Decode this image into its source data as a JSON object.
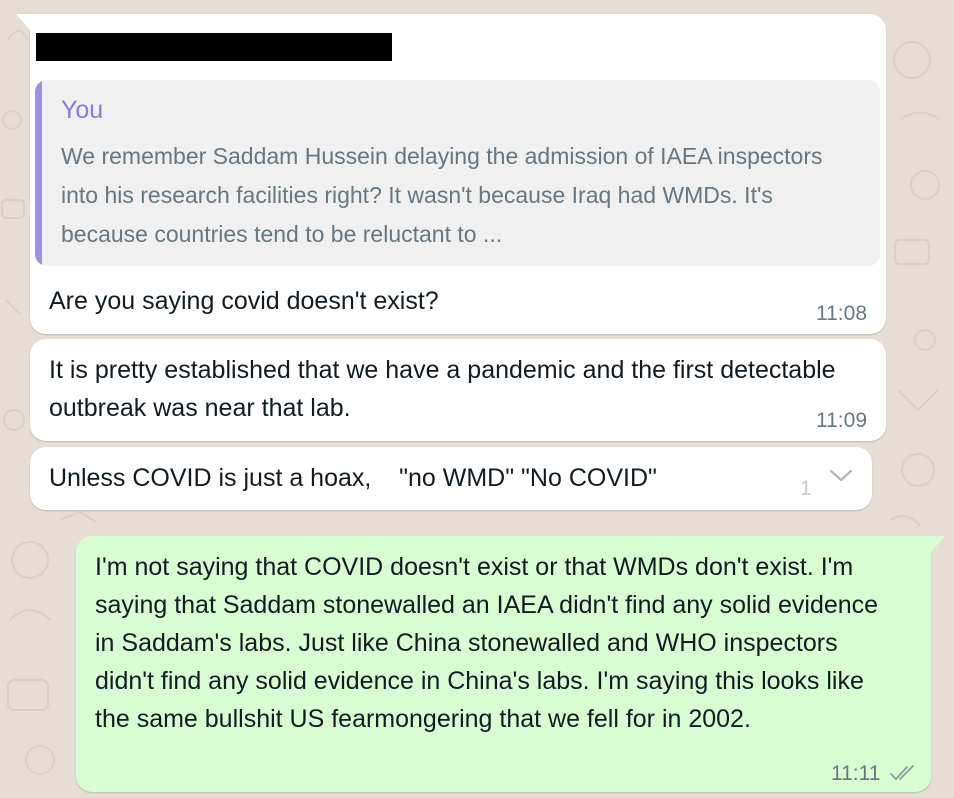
{
  "chat": {
    "messages": [
      {
        "direction": "incoming",
        "reply_quote": {
          "author": "You",
          "text": "We remember Saddam Hussein delaying the admission of IAEA inspectors into his research facilities right? It wasn't because Iraq had WMDs. It's because countries tend to be reluctant to ..."
        },
        "text": "Are you saying covid doesn't exist?",
        "time": "11:08"
      },
      {
        "direction": "incoming",
        "text": "It is pretty established that we have a pandemic and the first detectable outbreak was near that lab.",
        "time": "11:09"
      },
      {
        "direction": "incoming",
        "text": "Unless COVID is just a hoax,    \"no WMD\" \"No COVID\"",
        "faint_count": "1",
        "menu_icon": "chevron-down-icon"
      },
      {
        "direction": "outgoing",
        "text": "I'm not saying that COVID doesn't exist or that WMDs don't exist. I'm saying that Saddam stonewalled an IAEA didn't find any solid evidence in Saddam's labs. Just like China stonewalled and WHO inspectors didn't find any solid evidence in China's labs. I'm saying this looks like the same bullshit US fearmongering that we fell for in 2002.",
        "time": "11:11",
        "status_icon": "double-check-icon"
      }
    ]
  },
  "colors": {
    "background": "#e6ded5",
    "incoming_bubble": "#ffffff",
    "outgoing_bubble": "#d9fdd3",
    "quote_accent": "#9f8fe0",
    "quote_author": "#8a7ad8",
    "timestamp": "#667781"
  }
}
